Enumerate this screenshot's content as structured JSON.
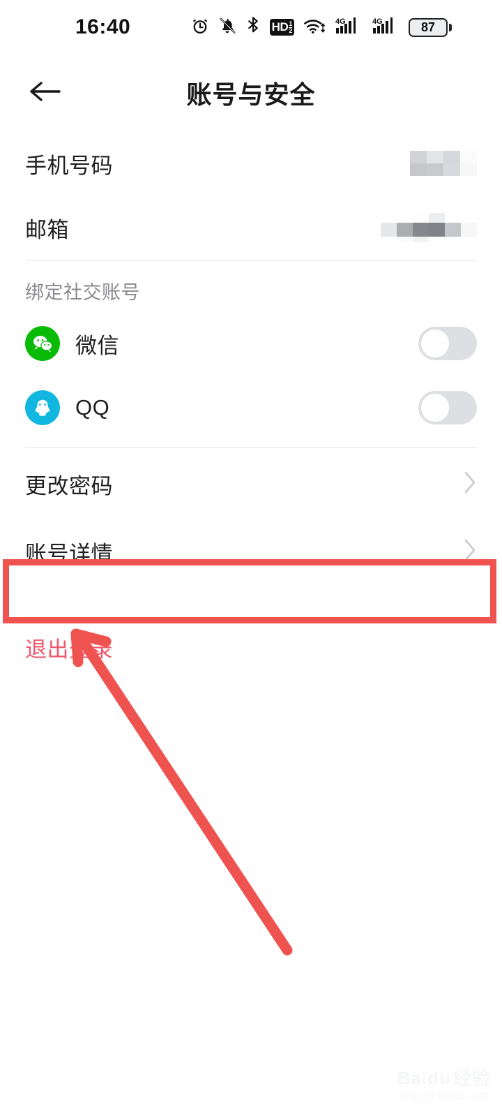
{
  "status_bar": {
    "time": "16:40",
    "battery_percent": "87",
    "hd_label": "HD",
    "signal_label_1": "4G",
    "signal_label_2": "4G",
    "icons": [
      "alarm-icon",
      "bell-muted-icon",
      "bluetooth-icon",
      "hd-volte-icon",
      "wifi-icon",
      "signal-4g-icon",
      "signal-4g-icon",
      "battery-icon"
    ]
  },
  "appbar": {
    "back_icon": "back-arrow-icon",
    "title": "账号与安全"
  },
  "account_rows": [
    {
      "label": "手机号码",
      "value": "",
      "value_state": "blurred"
    },
    {
      "label": "邮箱",
      "value": "",
      "value_state": "blurred"
    }
  ],
  "social": {
    "section_label": "绑定社交账号",
    "items": [
      {
        "name": "微信",
        "icon": "wechat-icon",
        "color": "#09BB07",
        "toggle_on": false
      },
      {
        "name": "QQ",
        "icon": "qq-icon",
        "color": "#12B7E0",
        "toggle_on": false
      }
    ]
  },
  "action_rows": [
    {
      "label": "更改密码",
      "chevron": "chevron-right-icon",
      "highlighted": false
    },
    {
      "label": "账号详情",
      "chevron": "chevron-right-icon",
      "highlighted": true
    }
  ],
  "logout": {
    "label": "退出登录",
    "color": "#f0566a"
  },
  "annotation": {
    "highlight_color": "#ef5350",
    "arrow_color": "#ef5350",
    "target": "账号详情"
  },
  "watermark": {
    "brand": "Baidu",
    "suffix": "经验",
    "url": "jingyan.baidu.com"
  }
}
